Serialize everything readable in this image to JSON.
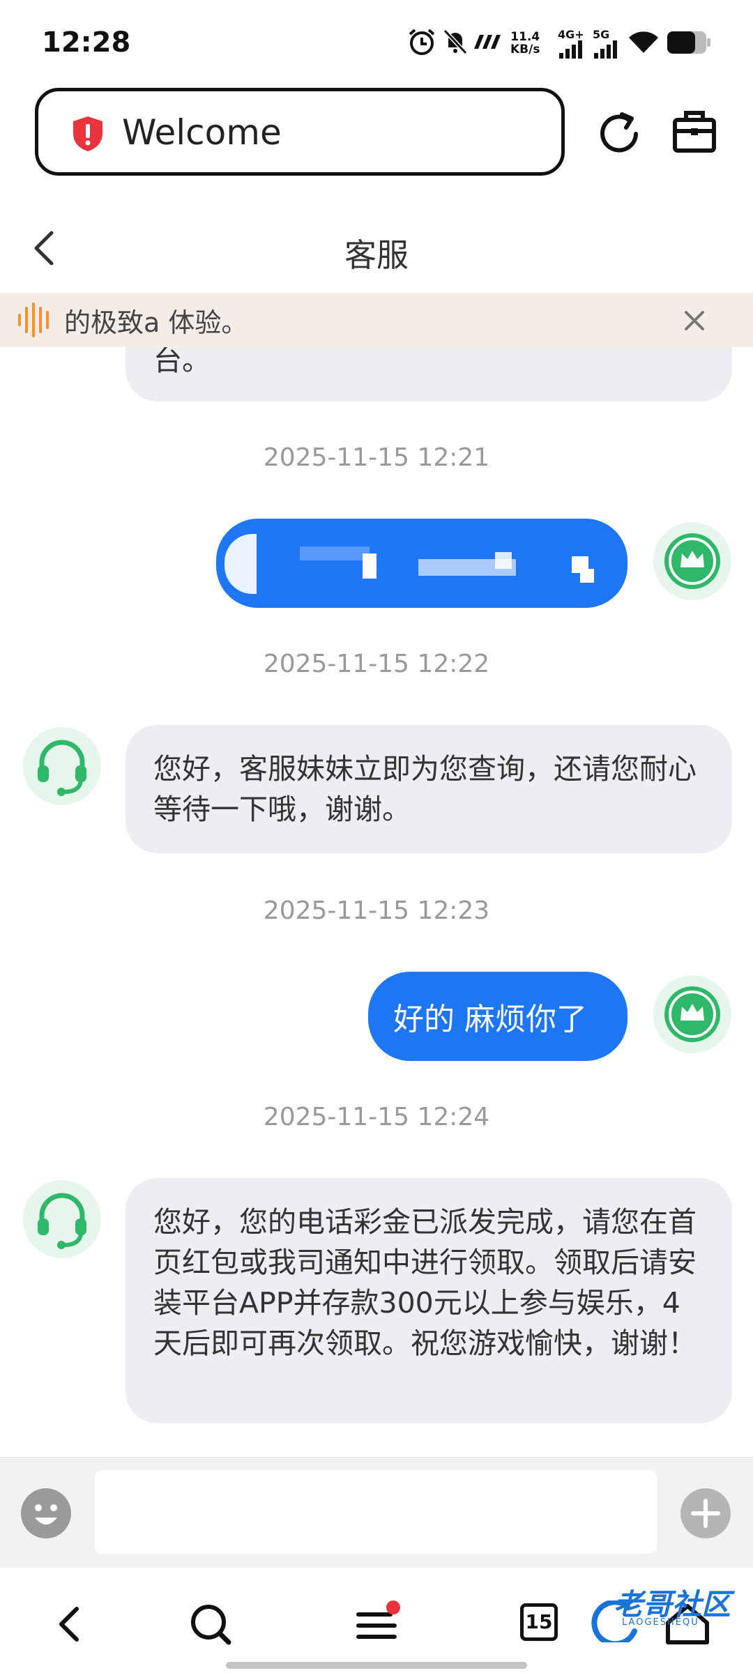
{
  "status_bar": {
    "time": "12:28",
    "speed_value": "11.4",
    "speed_unit": "KB/s",
    "net_4g": "4G+",
    "net_5g": "5G",
    "icons": [
      "alarm-icon",
      "mute-icon",
      "app-icon",
      "signal-icon",
      "signal-icon",
      "wifi-icon",
      "battery-icon"
    ]
  },
  "browser": {
    "url_text": "Welcome",
    "shield_color": "#e8323c"
  },
  "chat_header": {
    "title": "客服"
  },
  "notice": {
    "text": "的极致a 体验。"
  },
  "messages": [
    {
      "side": "left",
      "text": "台。",
      "partial": true
    },
    {
      "type": "timestamp",
      "text": "2025-11-15 12:21"
    },
    {
      "side": "right",
      "text": "",
      "obscured": true
    },
    {
      "type": "timestamp",
      "text": "2025-11-15 12:22"
    },
    {
      "side": "left",
      "text": "您好，客服妹妹立即为您查询，还请您耐心等待一下哦，谢谢。"
    },
    {
      "type": "timestamp",
      "text": "2025-11-15 12:23"
    },
    {
      "side": "right",
      "text": "好的 麻烦你了"
    },
    {
      "type": "timestamp",
      "text": "2025-11-15 12:24"
    },
    {
      "side": "left",
      "text": "您好，您的电话彩金已派发完成，请您在首页红包或我司通知中进行领取。领取后请安装平台APP并存款300元以上参与娱乐，4天后即可再次领取。祝您游戏愉快，谢谢！"
    }
  ],
  "input": {
    "placeholder": ""
  },
  "bottom_nav": {
    "tabs_count": "15"
  },
  "watermark": {
    "text": "老哥社区",
    "sub": "LAOGESHEQU"
  },
  "colors": {
    "accent_blue": "#1f76f5",
    "bubble_gray": "#eceef2",
    "avatar_green": "#2fb86a"
  }
}
